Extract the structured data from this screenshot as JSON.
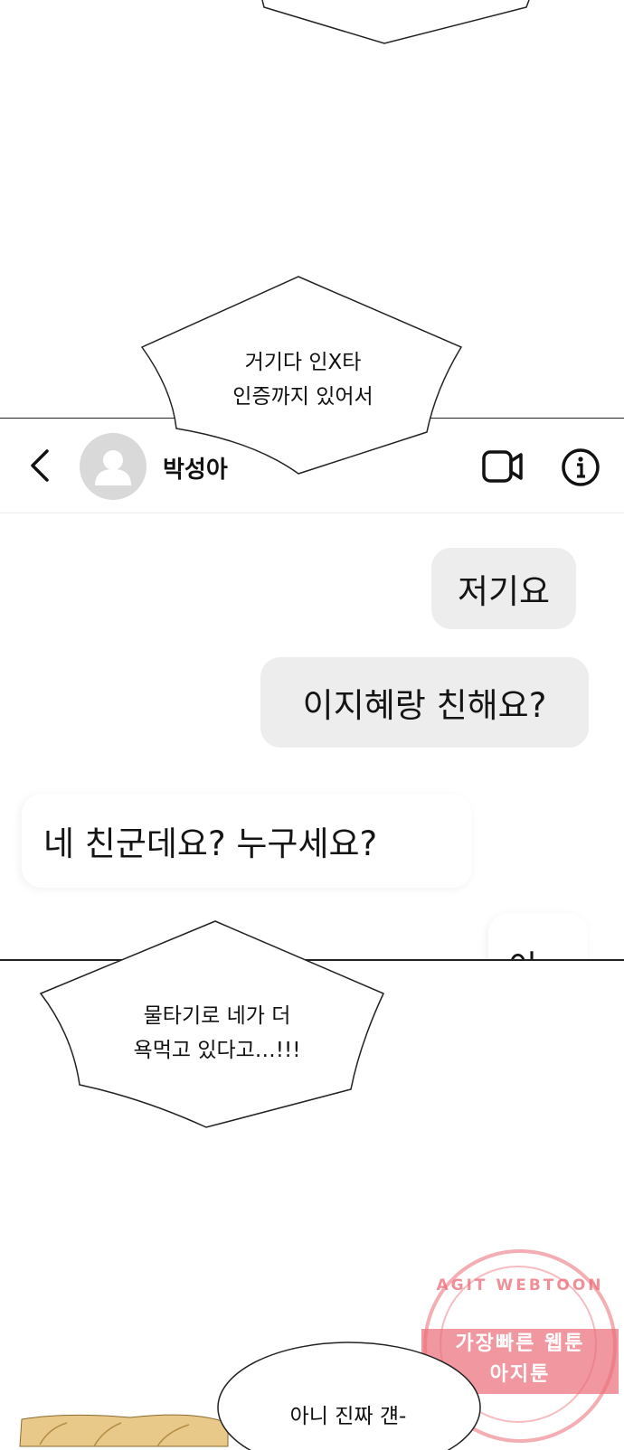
{
  "panel1": {
    "speech_top_partial": ""
  },
  "speech1": {
    "line1": "거기다 인X타",
    "line2": "인증까지 있어서"
  },
  "chat": {
    "contact_name": "박성아",
    "icons": {
      "back": "chevron-left-icon",
      "avatar": "default-profile-icon",
      "video": "video-call-icon",
      "info": "info-icon"
    },
    "messages": [
      {
        "side": "outgoing",
        "text": "저기요"
      },
      {
        "side": "outgoing",
        "text": "이지혜랑 친해요?"
      },
      {
        "side": "incoming",
        "text": "네 친군데요? 누구세요?"
      },
      {
        "side": "outgoing",
        "text": "아"
      }
    ]
  },
  "speech2": {
    "line1": "물타기로 네가 더",
    "line2": "욕먹고 있다고…!!!"
  },
  "speech3": {
    "text": "아니 진짜 걘-"
  },
  "watermark": {
    "top": "AGIT WEBTOON",
    "band_line1": "가장빠른 웹툰",
    "band_line2": "아지툰",
    "color": "#e8505c"
  },
  "colors": {
    "bubble_out": "#ededed",
    "bubble_in": "#ffffff",
    "avatar_bg": "#d9d9d9",
    "hair": "#e8c98a"
  }
}
